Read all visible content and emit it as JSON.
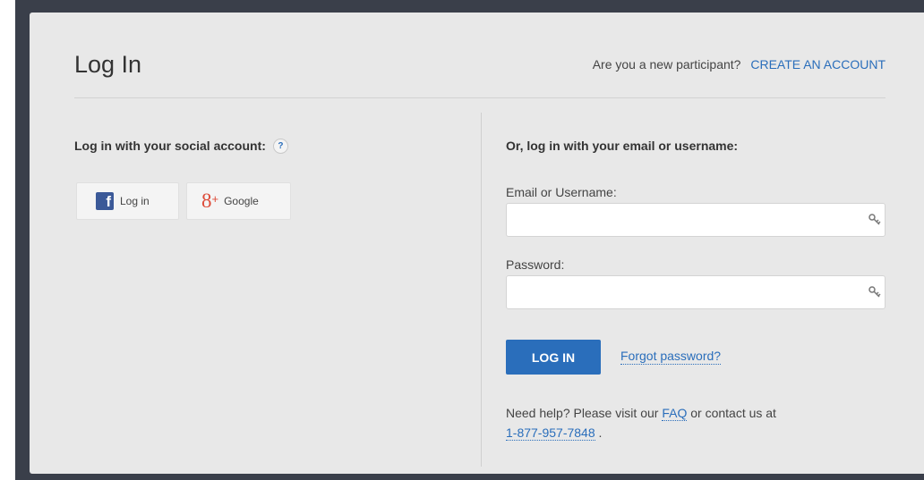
{
  "header": {
    "title": "Log In",
    "new_participant_question": "Are you a new participant?",
    "create_account_link": "CREATE AN ACCOUNT"
  },
  "social": {
    "heading": "Log in with your social account:",
    "help_badge": "?",
    "facebook": {
      "icon_glyph": "f",
      "label": "Log in",
      "icon": "facebook-icon",
      "color": "#3b5998"
    },
    "google": {
      "icon_glyph": "8",
      "icon_plus": "+",
      "label": "Google",
      "icon": "google-plus-icon",
      "color": "#dd4b39"
    }
  },
  "email_login": {
    "heading": "Or, log in with your email or username:",
    "username": {
      "label": "Email or Username:",
      "value": "",
      "placeholder": ""
    },
    "password": {
      "label": "Password:",
      "value": "",
      "placeholder": ""
    },
    "field_icon": "key-icon",
    "submit_label": "LOG IN",
    "forgot_link": "Forgot password?"
  },
  "help": {
    "prefix": "Need help? Please visit our",
    "faq_link": "FAQ",
    "middle": "or contact us at",
    "phone_link": "1-877-957-7848",
    "suffix": "."
  },
  "colors": {
    "accent": "#2a6ebb",
    "card_background": "#e8e8e8",
    "backdrop": "#3a3f4a"
  }
}
